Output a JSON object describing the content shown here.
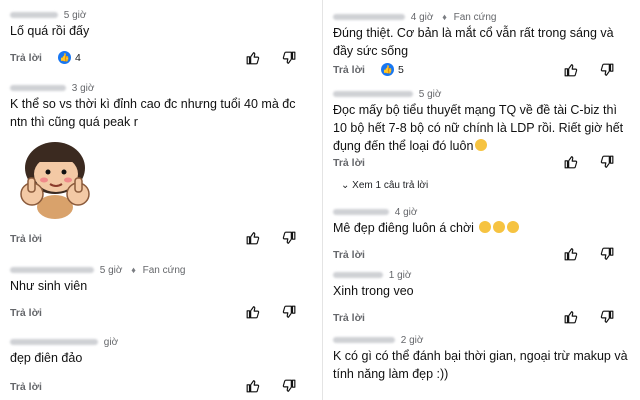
{
  "reply_label": "Trả lời",
  "fan_label": "Fan cứng",
  "left": [
    {
      "time": "5 giờ",
      "text": "Lố quá rồi đấy",
      "likes": "4",
      "fan": false
    },
    {
      "time": "3 giờ",
      "text": "K thể so vs thời kì đỉnh cao đc nhưng tuổi 40 mà đc ntn thì cũng quá peak r",
      "fan": false
    },
    {
      "time": "5 giờ",
      "text": "Như sinh viên",
      "fan": true
    },
    {
      "time": "giờ",
      "text": "đẹp điên đảo",
      "fan": false
    }
  ],
  "right": [
    {
      "time": "4 giờ",
      "text": "Đúng thiệt. Cơ bản là mắt cổ vẫn rất trong sáng và đầy sức sống",
      "likes": "5",
      "fan": true
    },
    {
      "time": "5 giờ",
      "text": "Đọc mấy bộ tiểu thuyết mạng TQ về đề tài C-biz thì 10 bộ hết 7-8 bộ có nữ chính là LDP rồi. Riết giờ hết đụng đến thể loại đó luôn",
      "fan": false
    },
    {
      "time": "4 giờ",
      "text": "Mê đẹp điêng luôn á chời",
      "fan": false
    },
    {
      "time": "1 giờ",
      "text": "Xinh trong veo",
      "fan": false
    },
    {
      "time": "2 giờ",
      "text": "K có gì có thể đánh bại thời gian, ngoại trừ makup và tính năng làm đẹp :))",
      "fan": false
    }
  ],
  "more_replies": "Xem 1 câu trả lời",
  "icons": {
    "like": "thumbs-up-icon",
    "dislike": "thumbs-down-icon",
    "fan": "diamond-icon",
    "chevron": "chevron-down-icon"
  },
  "colors": {
    "like_badge": "#1877f2",
    "meta": "#65676b"
  }
}
